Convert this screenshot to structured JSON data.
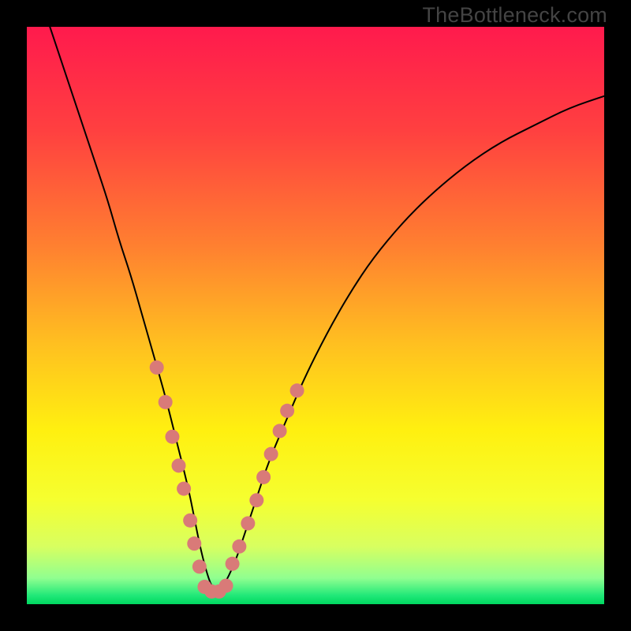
{
  "watermark": "TheBottleneck.com",
  "chart_data": {
    "type": "line",
    "title": "",
    "xlabel": "",
    "ylabel": "",
    "xlim": [
      0,
      100
    ],
    "ylim": [
      0,
      100
    ],
    "series": [
      {
        "name": "curve",
        "x": [
          4,
          6,
          8,
          10,
          12,
          14,
          16,
          18,
          20,
          22,
          24,
          26,
          28,
          29,
          30,
          31,
          32,
          33,
          34,
          36,
          38,
          40,
          42,
          45,
          48,
          52,
          56,
          60,
          65,
          70,
          76,
          82,
          88,
          94,
          100
        ],
        "y": [
          100,
          94,
          88,
          82,
          76,
          70,
          63,
          57,
          50,
          43,
          36,
          28,
          20,
          15,
          10,
          6,
          3,
          2,
          3,
          7,
          13,
          19,
          25,
          32,
          39,
          47,
          54,
          60,
          66,
          71,
          76,
          80,
          83,
          86,
          88
        ],
        "color": "#000000",
        "width": 2
      },
      {
        "name": "dots-left",
        "type": "scatter",
        "x": [
          22.5,
          24.0,
          25.2,
          26.3,
          27.2,
          28.3,
          29.0,
          29.9
        ],
        "y": [
          41.0,
          35.0,
          29.0,
          24.0,
          20.0,
          14.5,
          10.5,
          6.5
        ],
        "color": "#d97a78",
        "size": 9
      },
      {
        "name": "dots-bottom",
        "type": "scatter",
        "x": [
          30.8,
          32.0,
          33.3,
          34.5
        ],
        "y": [
          3.0,
          2.2,
          2.2,
          3.2
        ],
        "color": "#d97a78",
        "size": 9
      },
      {
        "name": "dots-right",
        "type": "scatter",
        "x": [
          35.6,
          36.8,
          38.3,
          39.8,
          41.0,
          42.3,
          43.8,
          45.1,
          46.8
        ],
        "y": [
          7.0,
          10.0,
          14.0,
          18.0,
          22.0,
          26.0,
          30.0,
          33.5,
          37.0
        ],
        "color": "#d97a78",
        "size": 9
      }
    ],
    "gradient": {
      "stops": [
        {
          "offset": 0.0,
          "color": "#ff1a4d"
        },
        {
          "offset": 0.18,
          "color": "#ff4040"
        },
        {
          "offset": 0.38,
          "color": "#ff8030"
        },
        {
          "offset": 0.55,
          "color": "#ffc020"
        },
        {
          "offset": 0.7,
          "color": "#fff010"
        },
        {
          "offset": 0.82,
          "color": "#f5ff30"
        },
        {
          "offset": 0.9,
          "color": "#d8ff60"
        },
        {
          "offset": 0.955,
          "color": "#90ff90"
        },
        {
          "offset": 0.985,
          "color": "#20e878"
        },
        {
          "offset": 1.0,
          "color": "#00d860"
        }
      ]
    }
  }
}
